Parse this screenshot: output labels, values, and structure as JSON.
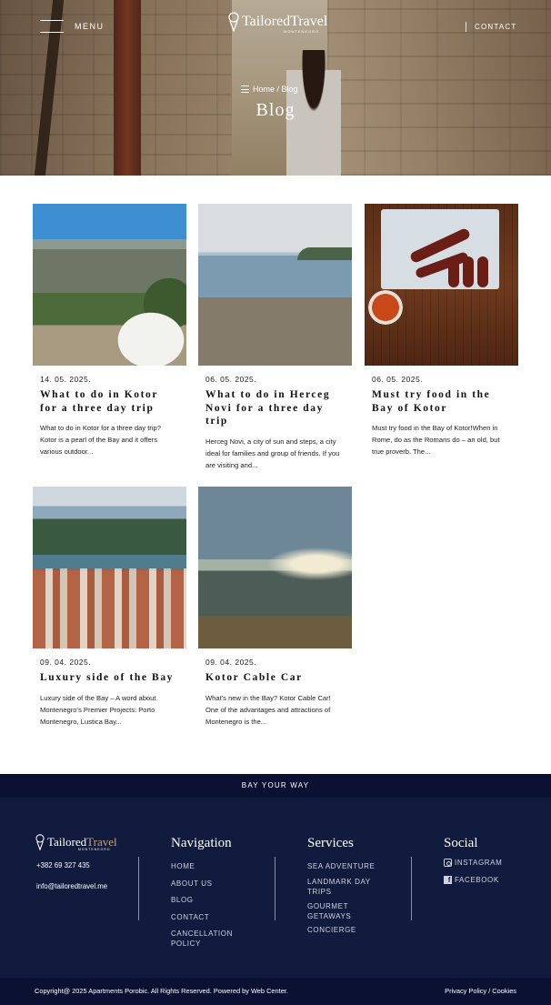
{
  "header": {
    "menu_label": "MENU",
    "brand_part1": "Tailored",
    "brand_part2": "Travel",
    "brand_sub": "MONTENEGRO",
    "contact_label": "CONTACT",
    "breadcrumb": "Home / Blog",
    "page_title": "Blog"
  },
  "posts": [
    {
      "date": "14. 05. 2025.",
      "title": "What to do in Kotor for a three day trip",
      "excerpt": "What to do in Kotor for a three day trip? Kotor is a pearl of the Bay and it offers various outdoor..."
    },
    {
      "date": "06. 05. 2025.",
      "title": "What to do in Herceg Novi for a three day trip",
      "excerpt": "Herceg Novi, a city of sun and steps, a city ideal for families and group of friends. If you are visiting and..."
    },
    {
      "date": "06. 05. 2025.",
      "title": "Must try food in the Bay of Kotor",
      "excerpt": "Must try food in the Bay of Kotor!When in Rome, do as the Romans do – an old, but true proverb. The..."
    },
    {
      "date": "09. 04. 2025.",
      "title": "Luxury side of the Bay",
      "excerpt": "Luxury side of the Bay – A word about Montenegro's Premier Projects: Porto Montenegro, Lustica Bay..."
    },
    {
      "date": "09. 04. 2025.",
      "title": "Kotor Cable Car",
      "excerpt": "What's new in the Bay? Kotor Cable Car! One of the advantages and attractions of Montenegro is the..."
    }
  ],
  "banner": {
    "text": "BAY YOUR WAY"
  },
  "footer": {
    "brand_part1": "Tailored",
    "brand_part2": "Travel",
    "brand_sub": "MONTENEGRO",
    "phone": "+382 69 327 435",
    "email": "info@tailoredtravel.me",
    "navigation": {
      "title": "Navigation",
      "links": [
        "HOME",
        "ABOUT US",
        "BLOG",
        "CONTACT",
        "CANCELLATION POLICY"
      ]
    },
    "services": {
      "title": "Services",
      "links": [
        "SEA ADVENTURE",
        "LANDMARK DAY TRIPS",
        "GOURMET GETAWAYS",
        "CONCIERGE"
      ]
    },
    "social": {
      "title": "Social",
      "links": [
        "INSTAGRAM",
        "FACEBOOK"
      ]
    },
    "copyright": "Copyright@ 2025 Apartments Porobic. All Rights Reserved. Powered by Web Center.",
    "legal": "Privacy Policy / Cookies"
  },
  "colors": {
    "footer_bg": "#101b3d",
    "banner_bg": "#0a1133",
    "brand_accent": "#c9a27a"
  }
}
